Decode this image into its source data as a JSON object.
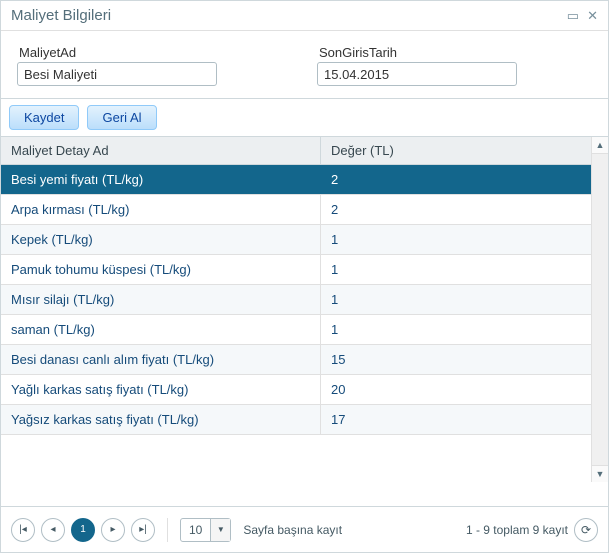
{
  "window": {
    "title": "Maliyet Bilgileri"
  },
  "form": {
    "name_label": "MaliyetAd",
    "name_value": "Besi Maliyeti",
    "date_label": "SonGirisTarih",
    "date_value": "15.04.2015"
  },
  "toolbar": {
    "save_label": "Kaydet",
    "undo_label": "Geri Al"
  },
  "grid": {
    "col_name": "Maliyet Detay Ad",
    "col_value": "Değer (TL)",
    "rows": [
      {
        "name": "Besi yemi fiyatı (TL/kg)",
        "value": "2",
        "selected": true
      },
      {
        "name": "Arpa kırması (TL/kg)",
        "value": "2"
      },
      {
        "name": "Kepek (TL/kg)",
        "value": "1"
      },
      {
        "name": "Pamuk tohumu küspesi (TL/kg)",
        "value": "1"
      },
      {
        "name": "Mısır silajı (TL/kg)",
        "value": "1"
      },
      {
        "name": "saman (TL/kg)",
        "value": "1"
      },
      {
        "name": "Besi danası canlı alım fiyatı (TL/kg)",
        "value": "15"
      },
      {
        "name": "Yağlı karkas satış fiyatı (TL/kg)",
        "value": "20"
      },
      {
        "name": "Yağsız karkas satış fiyatı (TL/kg)",
        "value": "17"
      }
    ]
  },
  "pager": {
    "current_page": "1",
    "page_size": "10",
    "page_size_label": "Sayfa başına kayıt",
    "info": "1 - 9 toplam 9 kayıt"
  }
}
